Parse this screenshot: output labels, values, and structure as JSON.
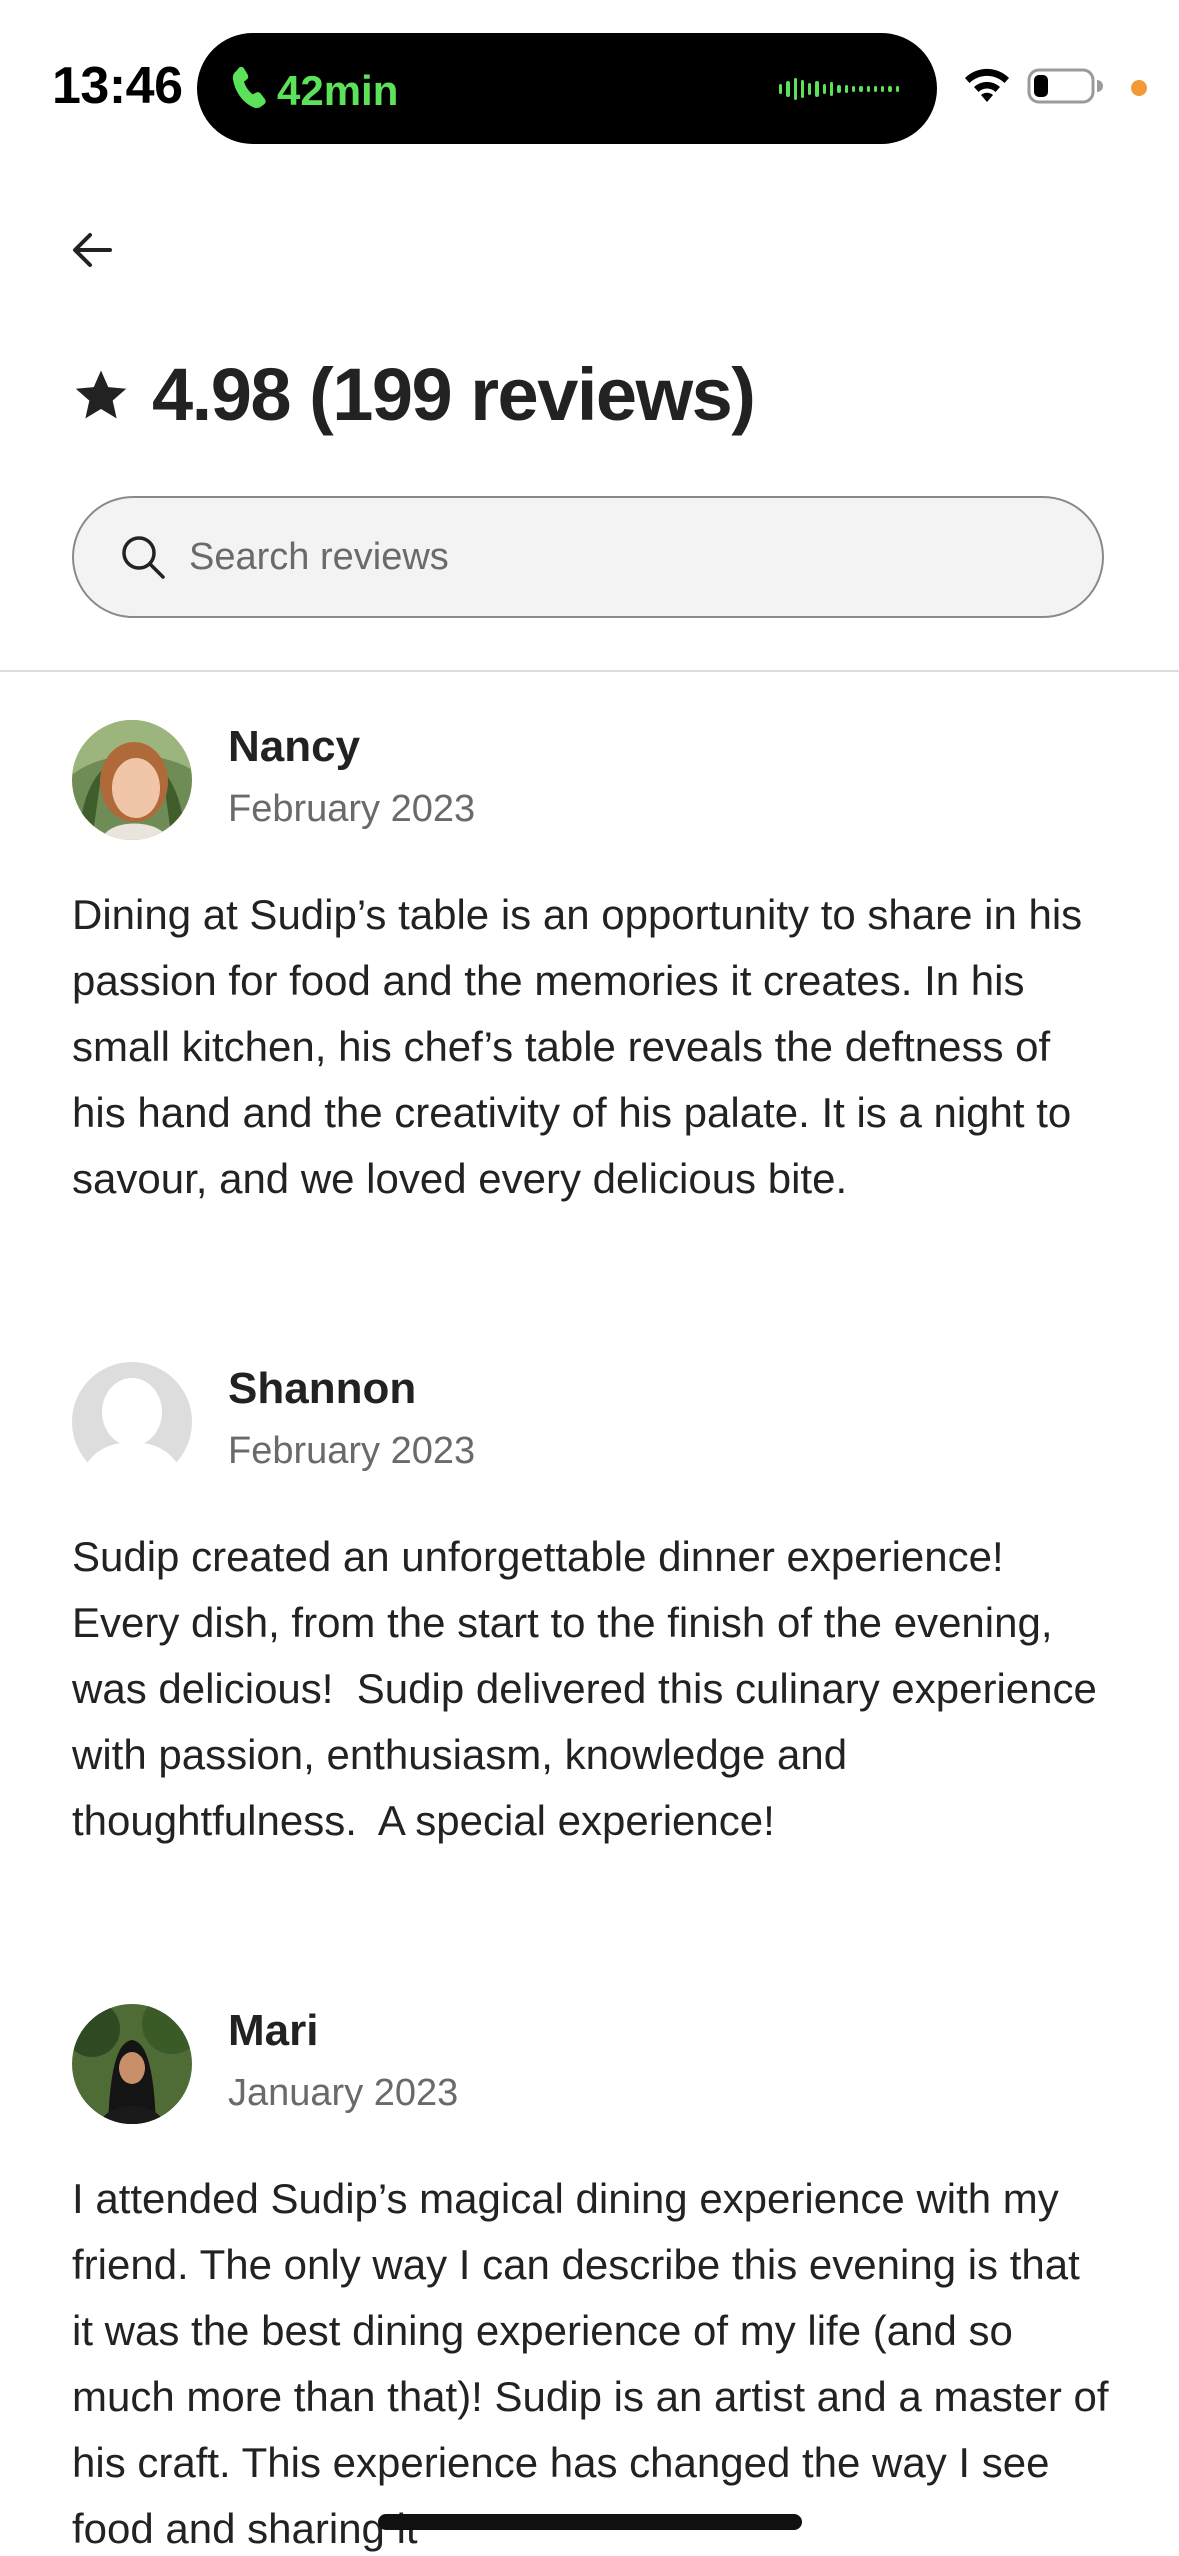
{
  "status_bar": {
    "time": "13:46",
    "call_duration": "42min",
    "call_color": "#5ce15a",
    "icons": [
      "phone-icon",
      "waveform-icon",
      "wifi-icon",
      "battery-icon",
      "privacy-dot"
    ]
  },
  "header": {
    "back_icon": "arrow-left-icon",
    "star_icon": "star-icon",
    "rating_title": "4.98 (199 reviews)"
  },
  "search": {
    "icon": "search-icon",
    "placeholder": "Search reviews",
    "value": ""
  },
  "reviews": [
    {
      "name": "Nancy",
      "date": "February 2023",
      "avatar": "photo-avatar",
      "text": "Dining at Sudip’s table is an opportunity to share in his passion for food and the memories it creates. In his small kitchen, his chef’s table reveals the deftness of his hand and the creativity of his palate. It is a night to savour, and we loved every delicious bite."
    },
    {
      "name": "Shannon",
      "date": "February 2023",
      "avatar": "default-avatar",
      "text": "Sudip created an unforgettable dinner experience!  Every dish, from the start to the finish of the evening, was delicious!  Sudip delivered this culinary experience with passion, enthusiasm, knowledge and thoughtfulness.  A special experience!"
    },
    {
      "name": "Mari",
      "date": "January 2023",
      "avatar": "photo-avatar",
      "text": "I attended Sudip’s magical dining experience with my friend. The only way I can describe this evening is that it was the best dining experience of my life (and so much more than that)! Sudip is an artist and a master of his craft. This experience has changed the way I see food and sharing it"
    }
  ],
  "colors": {
    "text_primary": "#222222",
    "text_secondary": "#6a6a6a",
    "search_background": "#f3f3f3",
    "divider": "#dddddd"
  }
}
